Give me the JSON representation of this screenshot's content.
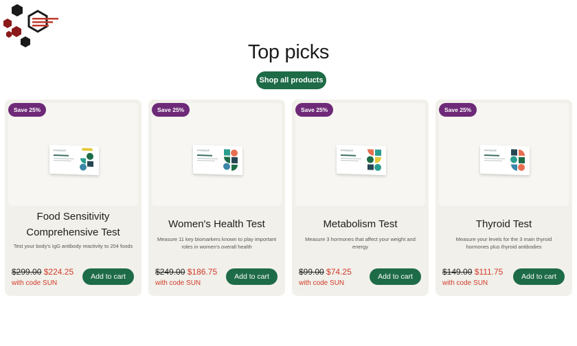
{
  "header": {
    "title": "Top picks",
    "shop_label": "Shop all products"
  },
  "colors": {
    "accent_green": "#1e6b47",
    "badge_purple": "#6e2a78",
    "sale_red": "#d23a2a",
    "card_bg": "#f1f0ea"
  },
  "products": [
    {
      "badge": "Save 25%",
      "title": "Food Sensitivity Comprehensive Test",
      "description": "Test your body's IgG antibody reactivity to 204 foods",
      "old_price": "$299.00",
      "new_price": "$224.25",
      "code_text": "with code SUN",
      "cart_label": "Add to cart"
    },
    {
      "badge": "Save 25%",
      "title": "Women's Health Test",
      "description": "Measure 11 key biomarkers known to play important roles in women's overall health",
      "old_price": "$249.00",
      "new_price": "$186.75",
      "code_text": "with code SUN",
      "cart_label": "Add to cart"
    },
    {
      "badge": "Save 25%",
      "title": "Metabolism Test",
      "description": "Measure 3 hormones that affect your weight and energy",
      "old_price": "$99.00",
      "new_price": "$74.25",
      "code_text": "with code SUN",
      "cart_label": "Add to cart"
    },
    {
      "badge": "Save 25%",
      "title": "Thyroid Test",
      "description": "Measure your levels for the 3 main thyroid hormones plus thyroid antibodies",
      "old_price": "$149.00",
      "new_price": "$111.75",
      "code_text": "with code SUN",
      "cart_label": "Add to cart"
    }
  ]
}
